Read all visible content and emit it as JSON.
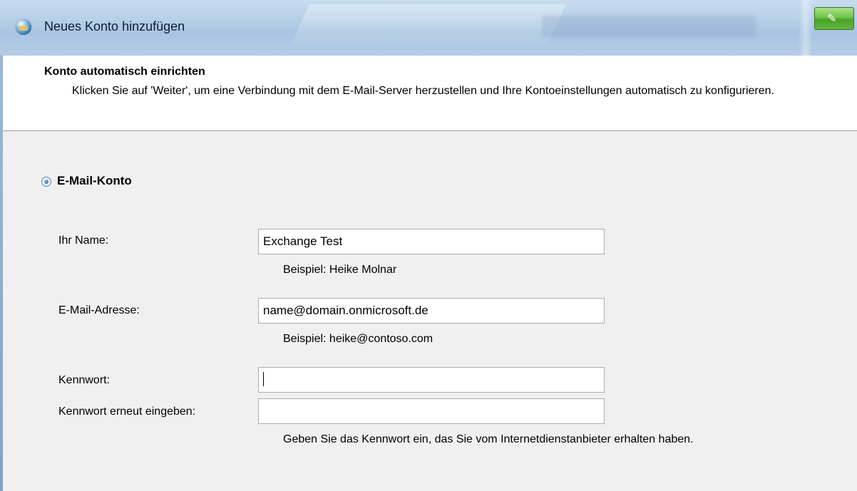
{
  "window": {
    "title": "Neues Konto hinzufügen"
  },
  "header": {
    "title": "Konto automatisch einrichten",
    "description": "Klicken Sie auf 'Weiter', um eine Verbindung mit dem E-Mail-Server herzustellen und Ihre Kontoeinstellungen automatisch zu konfigurieren."
  },
  "account_option": {
    "label": "E-Mail-Konto",
    "selected": true
  },
  "form": {
    "name": {
      "label": "Ihr Name:",
      "value": "Exchange Test",
      "hint": "Beispiel: Heike Molnar"
    },
    "email": {
      "label": "E-Mail-Adresse:",
      "value": "name@domain.onmicrosoft.de",
      "hint": "Beispiel: heike@contoso.com"
    },
    "password": {
      "label": "Kennwort:",
      "value": ""
    },
    "password_repeat": {
      "label": "Kennwort erneut eingeben:",
      "value": ""
    },
    "password_hint": "Geben Sie das Kennwort ein, das Sie vom Internetdienstanbieter erhalten haben."
  },
  "colors": {
    "titlebar": "#b7cfe8",
    "header_bg": "#ffffff",
    "body_bg": "#f0f0f0",
    "corner_button": "#5fb83c"
  },
  "icons": {
    "window_icon": "globe-mail-icon",
    "corner_button_icon": "edit-icon"
  }
}
